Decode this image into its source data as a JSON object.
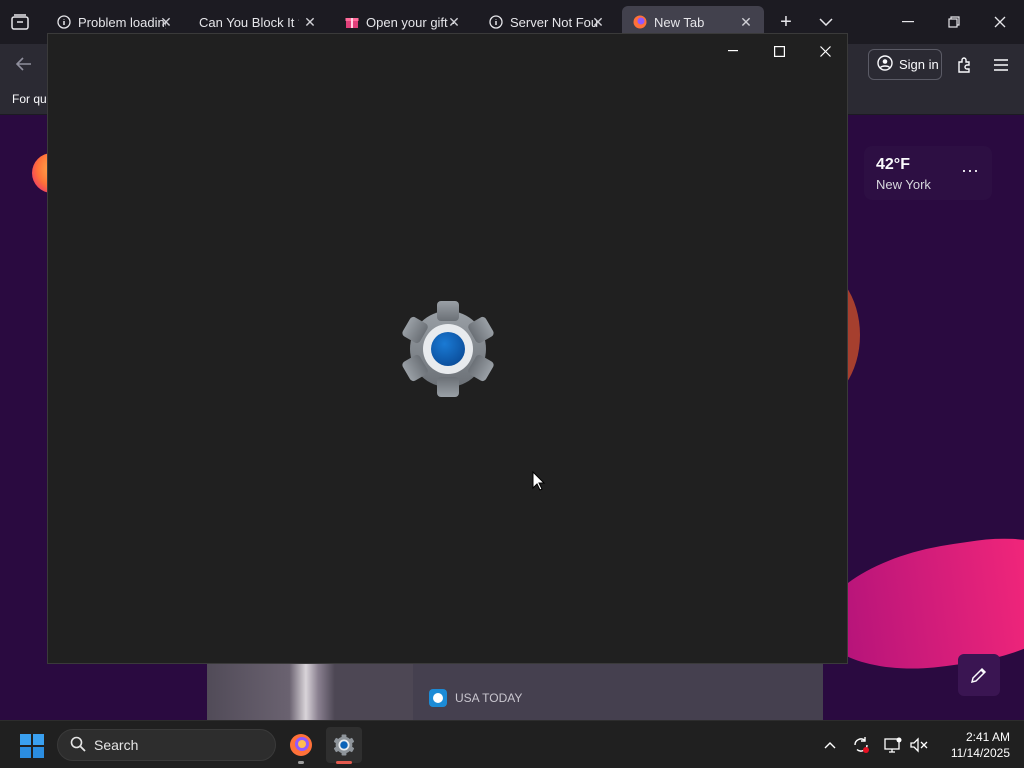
{
  "browser": {
    "tabs": [
      {
        "label": "Problem loading",
        "icon": "info-icon",
        "active": false
      },
      {
        "label": "Can You Block It ?",
        "icon": "none",
        "active": false
      },
      {
        "label": "Open your gift -",
        "icon": "gift-icon",
        "active": false
      },
      {
        "label": "Server Not Foun",
        "icon": "info-icon",
        "active": false
      },
      {
        "label": "New Tab",
        "icon": "firefox-icon",
        "active": true
      }
    ],
    "signin_label": "Sign in",
    "bookmarks_text": "For qui"
  },
  "newtab": {
    "weather": {
      "temp": "42°F",
      "city": "New York"
    },
    "story_source": "USA TODAY"
  },
  "taskbar": {
    "search_placeholder": "Search",
    "time": "2:41 AM",
    "date": "11/14/2025"
  },
  "colors": {
    "accent": "#0067c0",
    "page_bg": "#2a0a40",
    "splash_bg": "#202020"
  }
}
